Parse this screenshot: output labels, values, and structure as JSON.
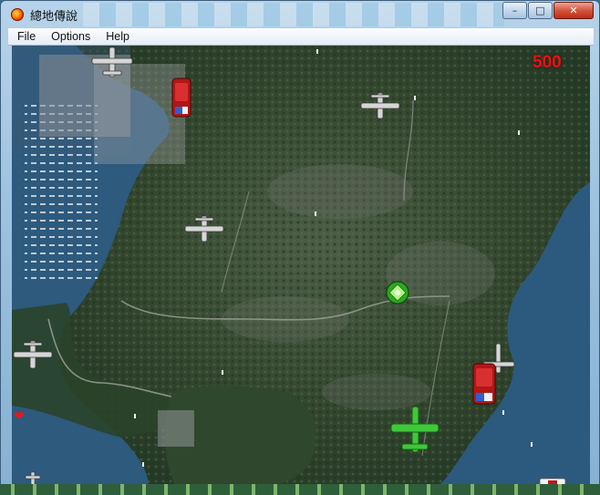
{
  "window": {
    "title": "總地傳說",
    "buttons": {
      "minimize": "–",
      "maximize": "□",
      "close": "✕"
    }
  },
  "menu": {
    "items": [
      "File",
      "Options",
      "Help"
    ]
  },
  "hud": {
    "score": "500",
    "lives_icon": "heart-icon"
  },
  "sprites": {
    "enemy_plane_icon": "gray-fighter-plane-icon",
    "enemy_tank_icon": "red-armored-vehicle-icon",
    "player_plane_icon": "green-fighter-plane-icon",
    "powerup_icon": "green-gem-powerup-icon"
  },
  "colors": {
    "score": "#e31515",
    "player": "#3ec83a",
    "enemy_plane": "#d8d8d8",
    "enemy_vehicle": "#c01818",
    "sea": "#2e5f86",
    "land": "#2d4a2c"
  }
}
